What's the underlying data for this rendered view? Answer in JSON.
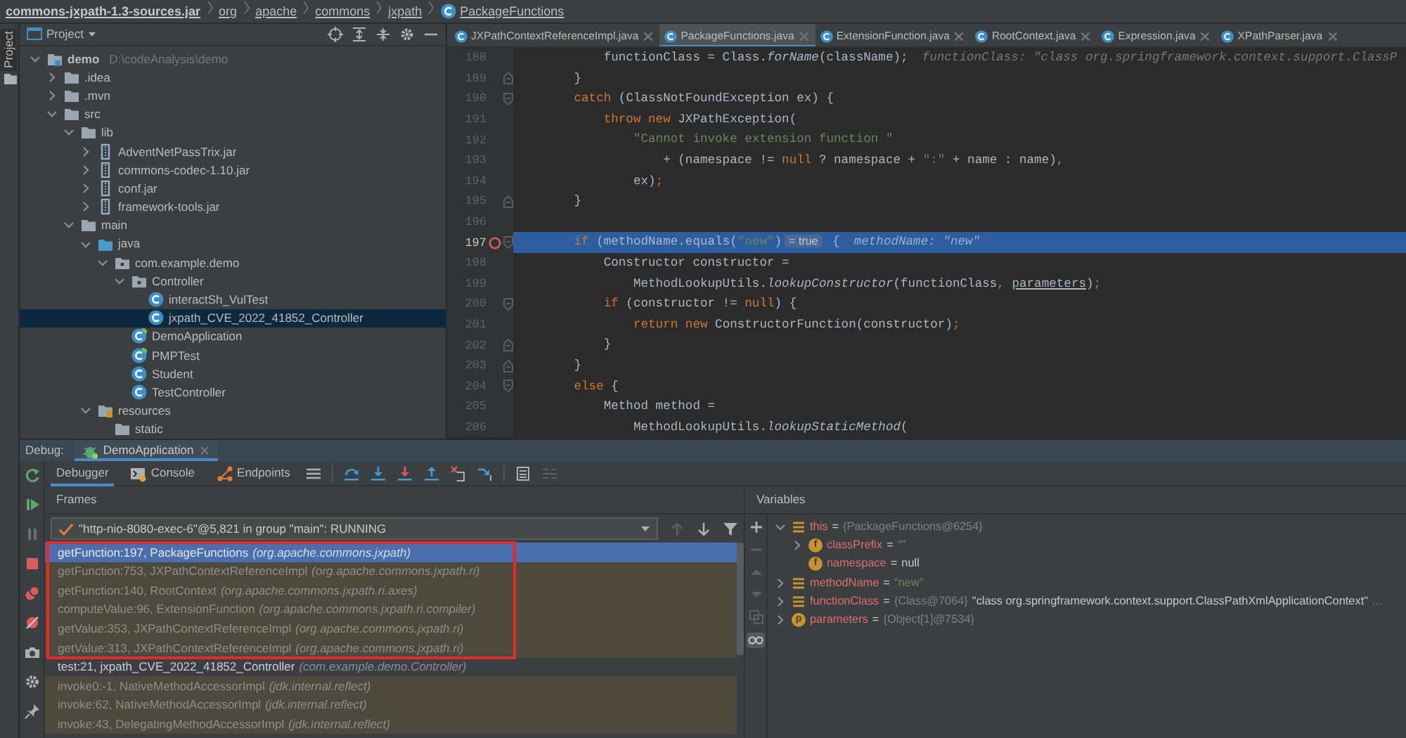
{
  "breadcrumb": [
    {
      "text": "commons-jxpath-1.3-sources.jar",
      "kind": "archive"
    },
    {
      "text": "org",
      "kind": "package"
    },
    {
      "text": "apache",
      "kind": "package"
    },
    {
      "text": "commons",
      "kind": "package"
    },
    {
      "text": "jxpath",
      "kind": "package"
    },
    {
      "text": "PackageFunctions",
      "kind": "class"
    }
  ],
  "side_strip": {
    "label": "Project"
  },
  "project": {
    "title": "Project",
    "tree": [
      {
        "label": "demo",
        "kind": "module",
        "path": "D:\\codeAnalysis\\demo",
        "expanded": true,
        "selected": false,
        "children": [
          {
            "label": ".idea",
            "kind": "folder",
            "expanded": false,
            "selected": false
          },
          {
            "label": ".mvn",
            "kind": "folder",
            "expanded": false,
            "selected": false
          },
          {
            "label": "src",
            "kind": "folder",
            "expanded": true,
            "selected": false,
            "children": [
              {
                "label": "lib",
                "kind": "folder",
                "expanded": true,
                "selected": false,
                "children": [
                  {
                    "label": "AdventNetPassTrix.jar",
                    "kind": "jar",
                    "expanded": false,
                    "selected": false
                  },
                  {
                    "label": "commons-codec-1.10.jar",
                    "kind": "jar",
                    "expanded": false,
                    "selected": false
                  },
                  {
                    "label": "conf.jar",
                    "kind": "jar",
                    "expanded": false,
                    "selected": false
                  },
                  {
                    "label": "framework-tools.jar",
                    "kind": "jar",
                    "expanded": false,
                    "selected": false
                  }
                ]
              },
              {
                "label": "main",
                "kind": "folder",
                "expanded": true,
                "selected": false,
                "children": [
                  {
                    "label": "java",
                    "kind": "source-root",
                    "expanded": true,
                    "selected": false,
                    "children": [
                      {
                        "label": "com.example.demo",
                        "kind": "package",
                        "expanded": true,
                        "selected": false,
                        "children": [
                          {
                            "label": "Controller",
                            "kind": "package",
                            "expanded": true,
                            "selected": false,
                            "children": [
                              {
                                "label": "interactSh_VulTest",
                                "kind": "class",
                                "selected": false
                              },
                              {
                                "label": "jxpath_CVE_2022_41852_Controller",
                                "kind": "class",
                                "selected": true
                              }
                            ]
                          },
                          {
                            "label": "DemoApplication",
                            "kind": "spring-class",
                            "selected": false
                          },
                          {
                            "label": "PMPTest",
                            "kind": "spring-class",
                            "selected": false
                          },
                          {
                            "label": "Student",
                            "kind": "class",
                            "selected": false
                          },
                          {
                            "label": "TestController",
                            "kind": "class",
                            "selected": false
                          }
                        ]
                      }
                    ]
                  },
                  {
                    "label": "resources",
                    "kind": "resources",
                    "expanded": true,
                    "selected": false,
                    "children": [
                      {
                        "label": "static",
                        "kind": "folder",
                        "selected": false
                      }
                    ]
                  }
                ]
              }
            ]
          }
        ]
      }
    ]
  },
  "editor": {
    "tabs": [
      {
        "label": "JXPathContextReferenceImpl.java",
        "selected": false
      },
      {
        "label": "PackageFunctions.java",
        "selected": true
      },
      {
        "label": "ExtensionFunction.java",
        "selected": false
      },
      {
        "label": "RootContext.java",
        "selected": false
      },
      {
        "label": "Expression.java",
        "selected": false
      },
      {
        "label": "XPathParser.java",
        "selected": false
      }
    ],
    "lines": [
      {
        "number": "188",
        "kind": "plain",
        "highlighted": false,
        "breakpoint": false,
        "tokens": [
          {
            "kind": "plain",
            "text": "            functionClass = Class."
          },
          {
            "kind": "italic",
            "text": "forName"
          },
          {
            "kind": "plain",
            "text": "(className);"
          },
          {
            "kind": "hint",
            "text": "functionClass: \"class org.springframework.context.support.ClassP"
          }
        ]
      },
      {
        "number": "189",
        "kind": "fold-end",
        "highlighted": false,
        "breakpoint": false,
        "tokens": [
          {
            "kind": "plain",
            "text": "        }"
          }
        ]
      },
      {
        "number": "190",
        "kind": "fold-start",
        "highlighted": false,
        "breakpoint": false,
        "tokens": [
          {
            "kind": "keyword",
            "text": "        catch"
          },
          {
            "kind": "plain",
            "text": " (ClassNotFoundException ex) {"
          }
        ]
      },
      {
        "number": "191",
        "kind": "plain",
        "highlighted": false,
        "breakpoint": false,
        "tokens": [
          {
            "kind": "keyword",
            "text": "            throw new"
          },
          {
            "kind": "plain",
            "text": " JXPathException("
          }
        ]
      },
      {
        "number": "192",
        "kind": "plain",
        "highlighted": false,
        "breakpoint": false,
        "tokens": [
          {
            "kind": "string",
            "text": "                \"Cannot invoke extension function \""
          }
        ]
      },
      {
        "number": "193",
        "kind": "plain",
        "highlighted": false,
        "breakpoint": false,
        "tokens": [
          {
            "kind": "plain",
            "text": "                    + (namespace != "
          },
          {
            "kind": "keyword",
            "text": "null"
          },
          {
            "kind": "plain",
            "text": " ? namespace + "
          },
          {
            "kind": "string",
            "text": "\":\""
          },
          {
            "kind": "plain",
            "text": " + name : name)"
          },
          {
            "kind": "keyword",
            "text": ","
          }
        ]
      },
      {
        "number": "194",
        "kind": "plain",
        "highlighted": false,
        "breakpoint": false,
        "tokens": [
          {
            "kind": "plain",
            "text": "                ex)"
          },
          {
            "kind": "keyword",
            "text": ";"
          }
        ]
      },
      {
        "number": "195",
        "kind": "fold-end",
        "highlighted": false,
        "breakpoint": false,
        "tokens": [
          {
            "kind": "plain",
            "text": "        }"
          }
        ]
      },
      {
        "number": "196",
        "kind": "plain",
        "highlighted": false,
        "breakpoint": false
      },
      {
        "number": "197",
        "kind": "fold-start",
        "highlighted": true,
        "breakpoint": true,
        "tokens": [
          {
            "kind": "keyword",
            "text": "        if"
          },
          {
            "kind": "plain",
            "text": " (methodName.equals("
          },
          {
            "kind": "string",
            "text": "\"new\""
          },
          {
            "kind": "plain",
            "text": ")"
          },
          {
            "kind": "badge",
            "text": "= true"
          },
          {
            "kind": "plain",
            "text": " {"
          },
          {
            "kind": "hint",
            "text": "methodName: \"new\""
          }
        ]
      },
      {
        "number": "198",
        "kind": "plain",
        "highlighted": false,
        "breakpoint": false,
        "tokens": [
          {
            "kind": "plain",
            "text": "            Constructor constructor ="
          }
        ]
      },
      {
        "number": "199",
        "kind": "plain",
        "highlighted": false,
        "breakpoint": false,
        "tokens": [
          {
            "kind": "plain",
            "text": "                MethodLookupUtils."
          },
          {
            "kind": "italic",
            "text": "lookupConstructor"
          },
          {
            "kind": "plain",
            "text": "(functionClass"
          },
          {
            "kind": "keyword",
            "text": ", "
          },
          {
            "kind": "underline",
            "text": "parameters"
          },
          {
            "kind": "plain",
            "text": ")"
          },
          {
            "kind": "keyword",
            "text": ";"
          }
        ]
      },
      {
        "number": "200",
        "kind": "fold-start",
        "highlighted": false,
        "breakpoint": false,
        "tokens": [
          {
            "kind": "keyword",
            "text": "            if"
          },
          {
            "kind": "plain",
            "text": " (constructor != "
          },
          {
            "kind": "keyword",
            "text": "null"
          },
          {
            "kind": "plain",
            "text": ") {"
          }
        ]
      },
      {
        "number": "201",
        "kind": "plain",
        "highlighted": false,
        "breakpoint": false,
        "tokens": [
          {
            "kind": "keyword",
            "text": "                return new"
          },
          {
            "kind": "plain",
            "text": " ConstructorFunction(constructor)"
          },
          {
            "kind": "keyword",
            "text": ";"
          }
        ]
      },
      {
        "number": "202",
        "kind": "fold-end",
        "highlighted": false,
        "breakpoint": false,
        "tokens": [
          {
            "kind": "plain",
            "text": "            }"
          }
        ]
      },
      {
        "number": "203",
        "kind": "fold-end",
        "highlighted": false,
        "breakpoint": false,
        "tokens": [
          {
            "kind": "plain",
            "text": "        }"
          }
        ]
      },
      {
        "number": "204",
        "kind": "fold-start",
        "highlighted": false,
        "breakpoint": false,
        "tokens": [
          {
            "kind": "keyword",
            "text": "        else"
          },
          {
            "kind": "plain",
            "text": " {"
          }
        ]
      },
      {
        "number": "205",
        "kind": "plain",
        "highlighted": false,
        "breakpoint": false,
        "tokens": [
          {
            "kind": "plain",
            "text": "            Method method ="
          }
        ]
      },
      {
        "number": "206",
        "kind": "plain",
        "highlighted": false,
        "breakpoint": false,
        "tokens": [
          {
            "kind": "plain",
            "text": "                MethodLookupUtils."
          },
          {
            "kind": "italic",
            "text": "lookupStaticMethod"
          },
          {
            "kind": "plain",
            "text": "("
          }
        ]
      }
    ]
  },
  "debug": {
    "label": "Debug:",
    "session": "DemoApplication",
    "tabs": [
      {
        "label": "Debugger",
        "kind": "debugger",
        "selected": true
      },
      {
        "label": "Console",
        "kind": "console",
        "selected": false
      },
      {
        "label": "Endpoints",
        "kind": "endpoints",
        "selected": false
      }
    ],
    "frames": {
      "title": "Frames",
      "thread": "\"http-nio-8080-exec-6\"@5,821 in group \"main\": RUNNING",
      "items": [
        {
          "method": "getFunction:197, PackageFunctions",
          "package": "(org.apache.commons.jxpath)",
          "selected": true,
          "library": true,
          "marked": true
        },
        {
          "method": "getFunction:753, JXPathContextReferenceImpl",
          "package": "(org.apache.commons.jxpath.ri)",
          "selected": false,
          "library": true,
          "marked": true
        },
        {
          "method": "getFunction:140, RootContext",
          "package": "(org.apache.commons.jxpath.ri.axes)",
          "selected": false,
          "library": true,
          "marked": true
        },
        {
          "method": "computeValue:96, ExtensionFunction",
          "package": "(org.apache.commons.jxpath.ri.compiler)",
          "selected": false,
          "library": true,
          "marked": true
        },
        {
          "method": "getValue:353, JXPathContextReferenceImpl",
          "package": "(org.apache.commons.jxpath.ri)",
          "selected": false,
          "library": true,
          "marked": true
        },
        {
          "method": "getValue:313, JXPathContextReferenceImpl",
          "package": "(org.apache.commons.jxpath.ri)",
          "selected": false,
          "library": true,
          "marked": true
        },
        {
          "method": "test:21, jxpath_CVE_2022_41852_Controller",
          "package": "(com.example.demo.Controller)",
          "selected": false,
          "library": false,
          "marked": false
        },
        {
          "method": "invoke0:-1, NativeMethodAccessorImpl",
          "package": "(jdk.internal.reflect)",
          "selected": false,
          "library": true,
          "marked": false
        },
        {
          "method": "invoke:62, NativeMethodAccessorImpl",
          "package": "(jdk.internal.reflect)",
          "selected": false,
          "library": true,
          "marked": false
        },
        {
          "method": "invoke:43, DelegatingMethodAccessorImpl",
          "package": "(jdk.internal.reflect)",
          "selected": false,
          "library": true,
          "marked": false
        }
      ]
    },
    "variables": {
      "title": "Variables",
      "items": [
        {
          "name": "this",
          "kind": "local",
          "assign": "=",
          "ref": "{PackageFunctions@6254}",
          "expanded": true,
          "children": [
            {
              "name": "classPrefix",
              "kind": "field",
              "icon_letter": "f",
              "assign": "=",
              "value": {
                "kind": "string",
                "text": "\"\""
              },
              "expanded": false
            },
            {
              "name": "namespace",
              "kind": "field",
              "icon_letter": "f",
              "assign": "=",
              "value": {
                "kind": "plain",
                "text": "null"
              }
            }
          ]
        },
        {
          "name": "methodName",
          "kind": "local",
          "assign": "=",
          "value": {
            "kind": "string",
            "text": "\"new\""
          },
          "expanded": false
        },
        {
          "name": "functionClass",
          "kind": "local",
          "assign": "=",
          "ref": "{Class@7064}",
          "value": {
            "kind": "plain",
            "text": "\"class org.springframework.context.support.ClassPathXmlApplicationContext\""
          },
          "more": "...",
          "expanded": false
        },
        {
          "name": "parameters",
          "kind": "param",
          "icon_letter": "p",
          "assign": "=",
          "ref": "{Object[1]@7534}",
          "expanded": false
        }
      ]
    }
  }
}
